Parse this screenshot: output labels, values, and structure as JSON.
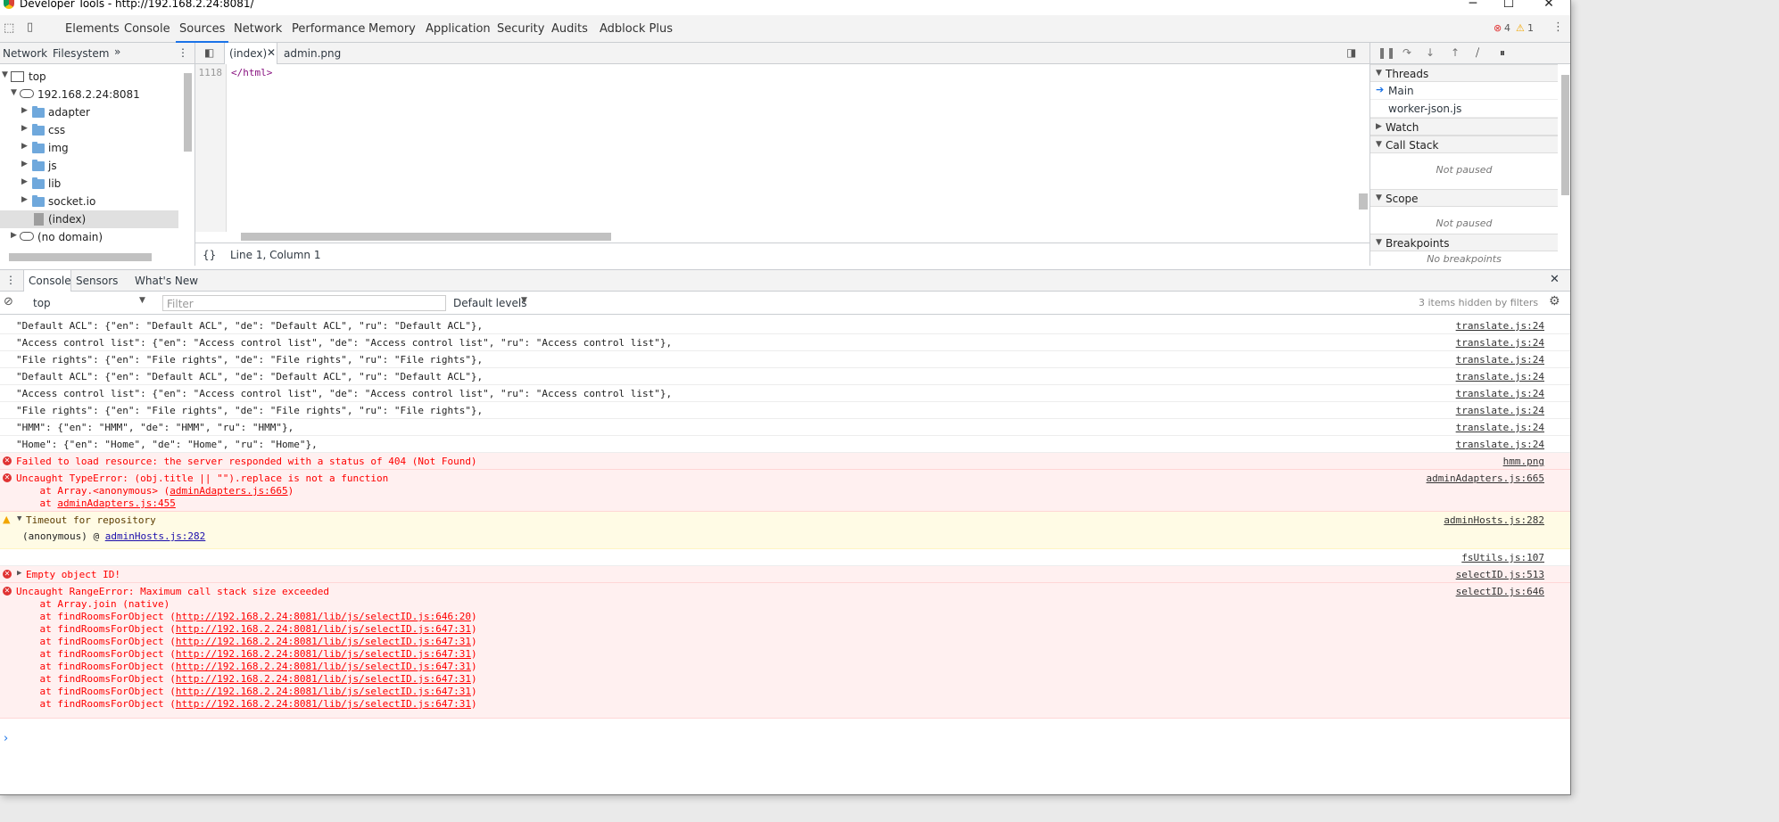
{
  "window": {
    "title": "Developer Tools - http://192.168.2.24:8081/"
  },
  "toolbar": {
    "tabs": [
      "Elements",
      "Console",
      "Sources",
      "Network",
      "Performance",
      "Memory",
      "Application",
      "Security",
      "Audits",
      "Adblock Plus"
    ],
    "active_tab": "Sources",
    "error_count": "4",
    "warning_count": "1"
  },
  "navigator": {
    "tabs": [
      "Network",
      "Filesystem"
    ],
    "more": "»",
    "tree": {
      "top": "top",
      "host": "192.168.2.24:8081",
      "folders": [
        "adapter",
        "css",
        "img",
        "js",
        "lib",
        "socket.io"
      ],
      "index_file": "(index)",
      "no_domain": "(no domain)"
    }
  },
  "editor": {
    "tabs": [
      "(index)",
      "admin.png"
    ],
    "line_number": "1118",
    "code": "</html>",
    "status": "Line 1, Column 1",
    "format_icon": "{}"
  },
  "debugger": {
    "threads_label": "Threads",
    "threads": [
      "Main",
      "worker-json.js"
    ],
    "watch_label": "Watch",
    "callstack_label": "Call Stack",
    "callstack_status": "Not paused",
    "scope_label": "Scope",
    "scope_status": "Not paused",
    "breakpoints_label": "Breakpoints",
    "breakpoints_status": "No breakpoints"
  },
  "drawer": {
    "tabs": [
      "Console",
      "Sensors",
      "What's New"
    ],
    "context": "top",
    "filter_placeholder": "Filter",
    "levels": "Default levels",
    "hidden_info": "3 items hidden by filters"
  },
  "console": {
    "messages": [
      {
        "type": "log",
        "text": "\"Default ACL\": {\"en\": \"Default ACL\", \"de\": \"Default ACL\", \"ru\": \"Default ACL\"},",
        "source": "translate.js:24"
      },
      {
        "type": "log",
        "text": "\"Access control list\": {\"en\": \"Access control list\", \"de\": \"Access control list\", \"ru\": \"Access control list\"},",
        "source": "translate.js:24"
      },
      {
        "type": "log",
        "text": "\"File rights\": {\"en\": \"File rights\", \"de\": \"File rights\", \"ru\": \"File rights\"},",
        "source": "translate.js:24"
      },
      {
        "type": "log",
        "text": "\"Default ACL\": {\"en\": \"Default ACL\", \"de\": \"Default ACL\", \"ru\": \"Default ACL\"},",
        "source": "translate.js:24"
      },
      {
        "type": "log",
        "text": "\"Access control list\": {\"en\": \"Access control list\", \"de\": \"Access control list\", \"ru\": \"Access control list\"},",
        "source": "translate.js:24"
      },
      {
        "type": "log",
        "text": "\"File rights\": {\"en\": \"File rights\", \"de\": \"File rights\", \"ru\": \"File rights\"},",
        "source": "translate.js:24"
      },
      {
        "type": "log",
        "text": "\"HMM\": {\"en\": \"HMM\", \"de\": \"HMM\", \"ru\": \"HMM\"},",
        "source": "translate.js:24"
      },
      {
        "type": "log",
        "text": "\"Home\": {\"en\": \"Home\", \"de\": \"Home\", \"ru\": \"Home\"},",
        "source": "translate.js:24"
      },
      {
        "type": "error",
        "text": "Failed to load resource: the server responded with a status of 404 (Not Found)",
        "source": "hmm.png"
      }
    ],
    "typeerror": {
      "text": "Uncaught TypeError: (obj.title || \"\").replace is not a function",
      "source": "adminAdapters.js:665",
      "stack1_prefix": "at Array.<anonymous> (",
      "stack1_link": "adminAdapters.js:665",
      "stack1_suffix": ")",
      "stack2_prefix": "at ",
      "stack2_link": "adminAdapters.js:455"
    },
    "warning": {
      "text": "Timeout for repository",
      "source": "adminHosts.js:282",
      "detail_prefix": "(anonymous) @ ",
      "detail_link": "adminHosts.js:282"
    },
    "fsutils_source": "fsUtils.js:107",
    "empty_object": {
      "text": "Empty object ID!",
      "source": "selectID.js:513"
    },
    "rangeerror": {
      "text": "Uncaught RangeError: Maximum call stack size exceeded",
      "source": "selectID.js:646",
      "stack_first": "at Array.join (native)",
      "stack_prefix": "at findRoomsForObject (",
      "stack_links": [
        "http://192.168.2.24:8081/lib/js/selectID.js:646:20",
        "http://192.168.2.24:8081/lib/js/selectID.js:647:31",
        "http://192.168.2.24:8081/lib/js/selectID.js:647:31",
        "http://192.168.2.24:8081/lib/js/selectID.js:647:31",
        "http://192.168.2.24:8081/lib/js/selectID.js:647:31",
        "http://192.168.2.24:8081/lib/js/selectID.js:647:31",
        "http://192.168.2.24:8081/lib/js/selectID.js:647:31",
        "http://192.168.2.24:8081/lib/js/selectID.js:647:31",
        "http://192.168.2.24:8081/lib/js/selectID.js:647:31"
      ],
      "stack_suffix": ")"
    },
    "prompt": "›"
  }
}
